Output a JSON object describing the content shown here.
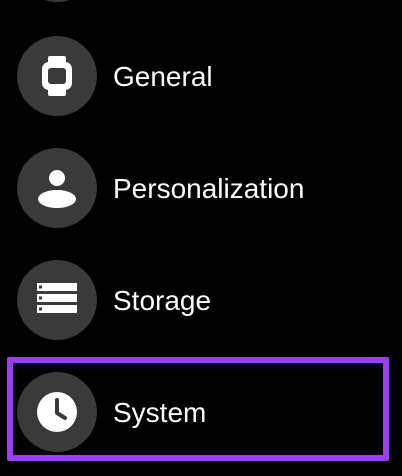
{
  "settings": {
    "items": [
      {
        "label": "General",
        "icon": "watch-icon"
      },
      {
        "label": "Personalization",
        "icon": "person-icon"
      },
      {
        "label": "Storage",
        "icon": "storage-icon"
      },
      {
        "label": "System",
        "icon": "clock-icon"
      }
    ]
  },
  "colors": {
    "background": "#000000",
    "icon_circle": "#3a3a3a",
    "highlight": "#9b3ff0",
    "text": "#ffffff"
  }
}
